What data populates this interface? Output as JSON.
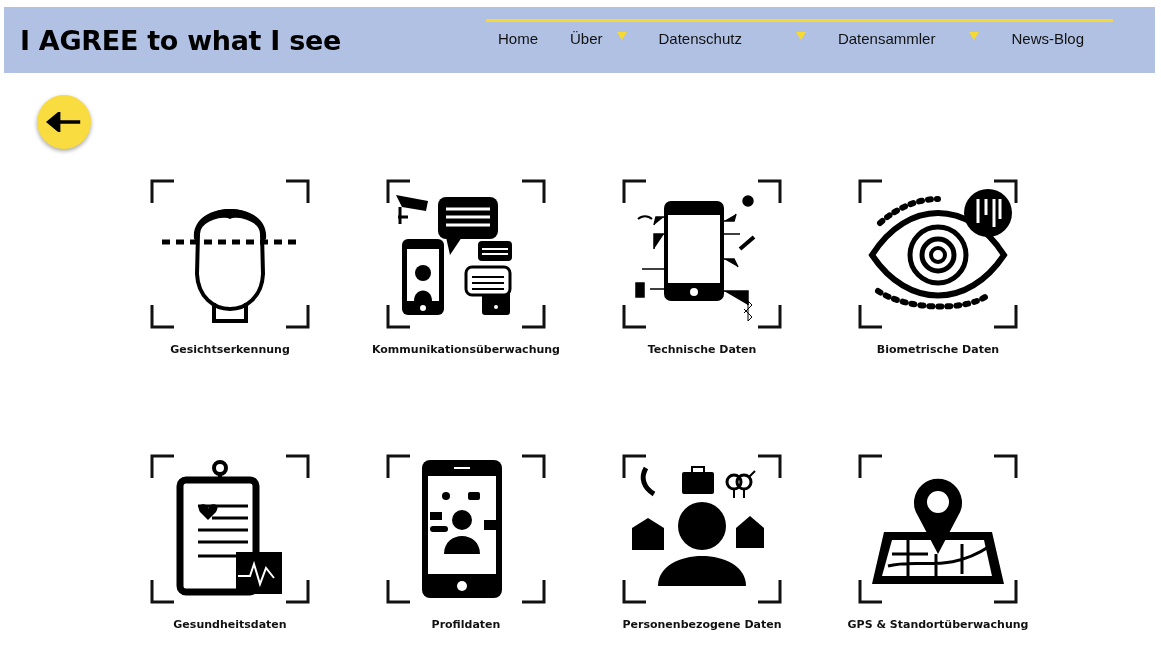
{
  "site_title": "I AGREE to what I see",
  "nav": [
    {
      "label": "Home",
      "has_dropdown": false
    },
    {
      "label": "Über",
      "has_dropdown": true
    },
    {
      "label": "Datenschutz",
      "has_dropdown": true
    },
    {
      "label": "Datensammler",
      "has_dropdown": true
    },
    {
      "label": "News-Blog",
      "has_dropdown": false
    }
  ],
  "tiles": [
    {
      "kind": "face",
      "caption": "Gesichtserkennung"
    },
    {
      "kind": "chat",
      "caption": "Kommunikationsüberwachung"
    },
    {
      "kind": "device",
      "caption": "Technische Daten"
    },
    {
      "kind": "eye",
      "caption": "Biometrische Daten"
    },
    {
      "kind": "clipboard",
      "caption": "Gesundheitsdaten"
    },
    {
      "kind": "profile",
      "caption": "Profildaten"
    },
    {
      "kind": "person",
      "caption": "Personenbezogene Daten"
    },
    {
      "kind": "map",
      "caption": "GPS & Standortüberwachung"
    }
  ]
}
